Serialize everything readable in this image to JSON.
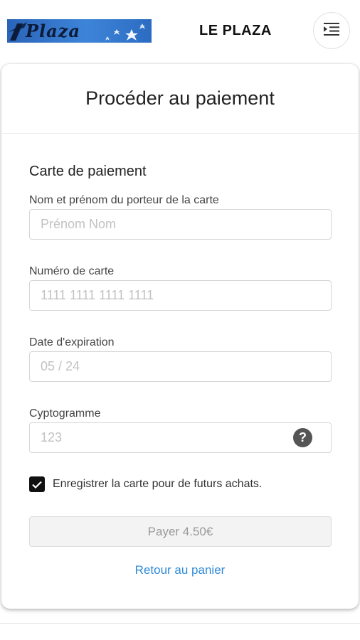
{
  "header": {
    "logo_text": "Plaza",
    "title": "LE PLAZA",
    "menu_icon": "menu-indent-icon"
  },
  "page": {
    "title": "Procéder au paiement",
    "section_title": "Carte de paiement"
  },
  "form": {
    "holder": {
      "label": "Nom et prénom du porteur de la carte",
      "placeholder": "Prénom Nom",
      "value": ""
    },
    "number": {
      "label": "Numéro de carte",
      "placeholder": "1111 1111 1111 1111",
      "value": ""
    },
    "expiry": {
      "label": "Date d'expiration",
      "placeholder": "05 / 24",
      "value": ""
    },
    "cvv": {
      "label": "Cyptogramme",
      "placeholder": "123",
      "value": "",
      "help_icon": "question-circle-icon"
    },
    "save_card": {
      "label": "Enregistrer la carte pour de futurs achats.",
      "checked": true
    }
  },
  "actions": {
    "pay_label": "Payer 4.50€",
    "back_label": "Retour au panier"
  },
  "colors": {
    "link": "#2f8ad8",
    "logo_blue": "#3d84d8",
    "checkbox": "#111111"
  }
}
